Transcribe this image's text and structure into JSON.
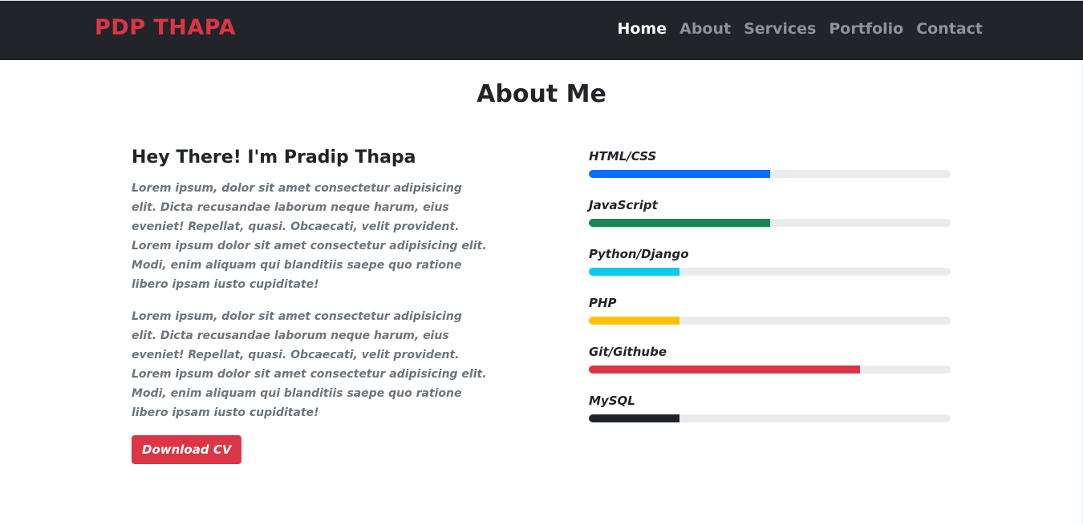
{
  "navbar": {
    "brand": "PDP THAPA",
    "brand_color": "#dc3545",
    "links": [
      {
        "label": "Home",
        "active": true
      },
      {
        "label": "About",
        "active": false
      },
      {
        "label": "Services",
        "active": false
      },
      {
        "label": "Portfolio",
        "active": false
      },
      {
        "label": "Contact",
        "active": false
      }
    ]
  },
  "about": {
    "title": "About Me",
    "heading": "Hey There! I'm Pradip Thapa",
    "paragraphs": [
      "Lorem ipsum, dolor sit amet consectetur adipisicing elit. Dicta recusandae laborum neque harum, eius eveniet! Repellat, quasi. Obcaecati, velit provident. Lorem ipsum dolor sit amet consectetur adipisicing elit. Modi, enim aliquam qui blanditiis saepe quo ratione libero ipsam iusto cupiditate!",
      "Lorem ipsum, dolor sit amet consectetur adipisicing elit. Dicta recusandae laborum neque harum, eius eveniet! Repellat, quasi. Obcaecati, velit provident. Lorem ipsum dolor sit amet consectetur adipisicing elit. Modi, enim aliquam qui blanditiis saepe quo ratione libero ipsam iusto cupiditate!"
    ],
    "download_label": "Download CV",
    "download_color": "#dc3545"
  },
  "skills": [
    {
      "name": "HTML/CSS",
      "percent": 50,
      "color": "#0d6efd"
    },
    {
      "name": "JavaScript",
      "percent": 50,
      "color": "#198754"
    },
    {
      "name": "Python/Django",
      "percent": 25,
      "color": "#0dcaf0"
    },
    {
      "name": "PHP",
      "percent": 25,
      "color": "#ffc107"
    },
    {
      "name": "Git/Githube",
      "percent": 75,
      "color": "#dc3545"
    },
    {
      "name": "MySQL",
      "percent": 25,
      "color": "#212529"
    }
  ]
}
